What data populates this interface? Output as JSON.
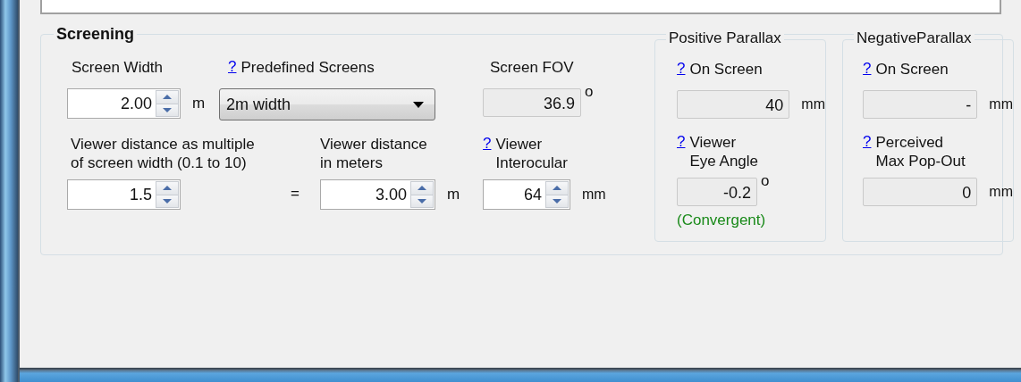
{
  "screening": {
    "title": "Screening",
    "screen_width": {
      "label": "Screen Width",
      "value": "2.00",
      "unit": "m"
    },
    "predefined": {
      "help": "?",
      "label": "Predefined Screens",
      "value": "2m width"
    },
    "fov": {
      "label": "Screen FOV",
      "value": "36.9",
      "unit": "o"
    },
    "viewer_multiple": {
      "label": "Viewer distance as multiple\nof screen width (0.1 to 10)",
      "value": "1.5"
    },
    "equals": "=",
    "viewer_meters": {
      "label": "Viewer distance\nin meters",
      "value": "3.00",
      "unit": "m"
    },
    "interocular": {
      "help": "?",
      "label": "Viewer\nInterocular",
      "value": "64",
      "unit": "mm"
    }
  },
  "positive_parallax": {
    "title": "Positive Parallax",
    "on_screen": {
      "help": "?",
      "label": "On Screen",
      "value": "40",
      "unit": "mm"
    },
    "eye_angle": {
      "help": "?",
      "label": "Viewer\nEye Angle",
      "value": "-0.2",
      "unit": "o",
      "note": "(Convergent)"
    }
  },
  "negative_parallax": {
    "title": "NegativeParallax",
    "on_screen": {
      "help": "?",
      "label": "On Screen",
      "value": "-",
      "unit": "mm"
    },
    "pop_out": {
      "help": "?",
      "label": "Perceived\nMax Pop-Out",
      "value": "0",
      "unit": "mm"
    }
  }
}
